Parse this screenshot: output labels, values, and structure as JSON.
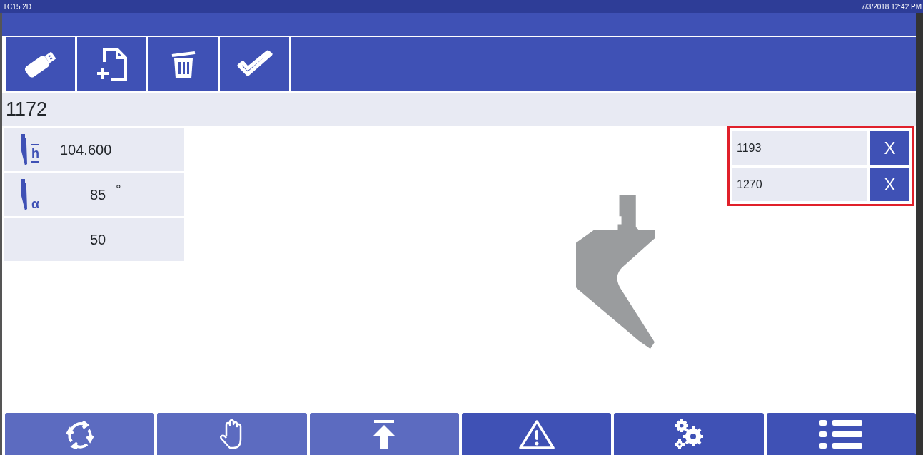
{
  "window": {
    "title": "TC15 2D",
    "clock": "7/3/2018 12:42 PM"
  },
  "toolbar": [
    {
      "kind": "usb"
    },
    {
      "kind": "new-file"
    },
    {
      "kind": "delete"
    },
    {
      "kind": "confirm"
    }
  ],
  "program": "1172",
  "parameters": [
    {
      "kind": "height",
      "symbol": "h",
      "value": "104.600"
    },
    {
      "kind": "angle",
      "symbol": "α",
      "value": "85",
      "unit": "°"
    },
    {
      "kind": "plain",
      "value": "50"
    }
  ],
  "tool_list": {
    "highlighted": true,
    "items": [
      {
        "label": "1193",
        "remove": "X"
      },
      {
        "label": "1270",
        "remove": "X"
      }
    ]
  },
  "nav": [
    {
      "kind": "cycle",
      "disabled": true
    },
    {
      "kind": "manual",
      "disabled": true
    },
    {
      "kind": "upload",
      "disabled": true
    },
    {
      "kind": "warning",
      "disabled": false
    },
    {
      "kind": "settings",
      "disabled": false
    },
    {
      "kind": "list",
      "disabled": false
    }
  ]
}
